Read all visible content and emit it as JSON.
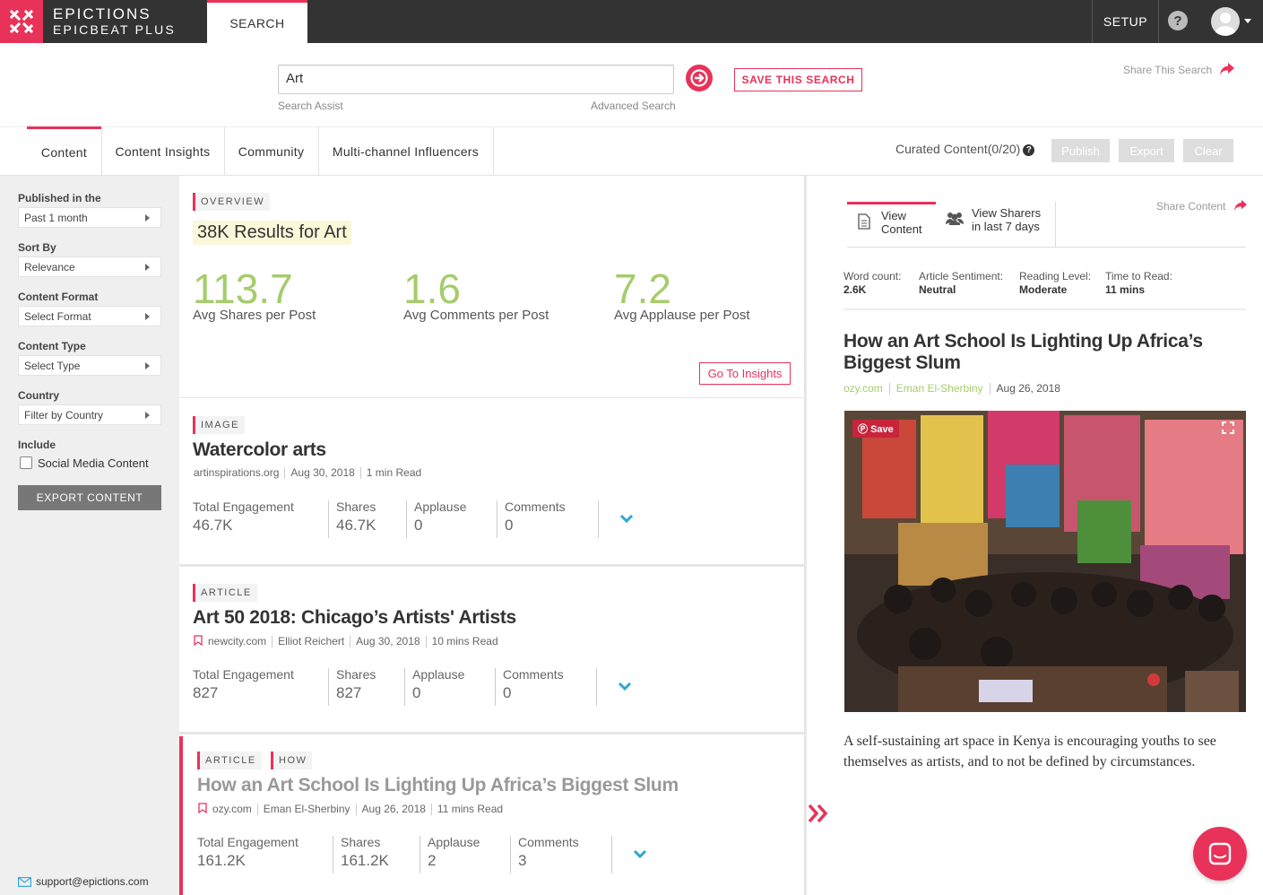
{
  "brand": {
    "line1": "EPICTIONS",
    "line2": "EPICBEAT PLUS"
  },
  "topnav": {
    "search": "SEARCH",
    "setup": "SETUP",
    "help": "?"
  },
  "search": {
    "value": "Art",
    "assist": "Search Assist",
    "advanced": "Advanced Search",
    "save_label": "SAVE THIS SEARCH",
    "share_label": "Share This Search"
  },
  "tabs": [
    "Content",
    "Content Insights",
    "Community",
    "Multi-channel Influencers"
  ],
  "curated": {
    "label": "Curated Content(0/20)",
    "publish": "Publish",
    "export": "Export",
    "clear": "Clear"
  },
  "sidebar": {
    "filters": [
      {
        "label": "Published in the",
        "value": "Past 1 month"
      },
      {
        "label": "Sort By",
        "value": "Relevance"
      },
      {
        "label": "Content Format",
        "value": "Select Format"
      },
      {
        "label": "Content Type",
        "value": "Select Type"
      },
      {
        "label": "Country",
        "value": "Filter by Country"
      }
    ],
    "include_label": "Include",
    "social_label": "Social Media Content",
    "export_label": "EXPORT CONTENT",
    "support": "support@epictions.com"
  },
  "overview": {
    "tag": "OVERVIEW",
    "count": "38K Results",
    "for_word": "for",
    "query": "Art",
    "stats": [
      {
        "value": "113.7",
        "label": "Avg Shares per Post"
      },
      {
        "value": "1.6",
        "label": "Avg Comments per Post"
      },
      {
        "value": "7.2",
        "label": "Avg Applause per Post"
      }
    ],
    "insights_label": "Go To Insights"
  },
  "eng_labels": {
    "total": "Total Engagement",
    "shares": "Shares",
    "applause": "Applause",
    "comments": "Comments"
  },
  "cards": [
    {
      "tags": [
        "IMAGE"
      ],
      "title": "Watercolor arts",
      "meta": [
        "artinspirations.org",
        "Aug 30, 2018",
        "1 min Read"
      ],
      "total": "46.7K",
      "shares": "46.7K",
      "applause": "0",
      "comments": "0"
    },
    {
      "tags": [
        "ARTICLE"
      ],
      "title": "Art 50 2018: Chicago’s Artists' Artists",
      "meta": [
        "newcity.com",
        "Elliot Reichert",
        "Aug 30, 2018",
        "10 mins Read"
      ],
      "total": "827",
      "shares": "827",
      "applause": "0",
      "comments": "0"
    },
    {
      "tags": [
        "ARTICLE",
        "HOW"
      ],
      "title": "How an Art School Is Lighting Up Africa’s Biggest Slum",
      "meta": [
        "ozy.com",
        "Eman El-Sherbiny",
        "Aug 26, 2018",
        "11 mins Read"
      ],
      "total": "161.2K",
      "shares": "161.2K",
      "applause": "2",
      "comments": "3"
    }
  ],
  "detail": {
    "tab_view_1": "View",
    "tab_view_2": "Content",
    "tab_sharers_1": "View Sharers",
    "tab_sharers_2": "in last 7 days",
    "share_label": "Share Content",
    "stats": [
      {
        "label": "Word count:",
        "value": "2.6K"
      },
      {
        "label": "Article Sentiment:",
        "value": "Neutral"
      },
      {
        "label": "Reading Level:",
        "value": "Moderate"
      },
      {
        "label": "Time to Read:",
        "value": "11 mins"
      }
    ],
    "title": "How an Art School Is Lighting Up Africa’s Biggest Slum",
    "source": "ozy.com",
    "author": "Eman El-Sherbiny",
    "date": "Aug 26, 2018",
    "pin_label": "Save",
    "description": "A self-sustaining art space in Kenya is encouraging youths to see themselves as artists, and to not be defined by circumstances."
  },
  "colors": {
    "accent": "#e8325a",
    "green": "#a5cc6b",
    "topbar": "#333333",
    "sidebar": "#efefef"
  }
}
